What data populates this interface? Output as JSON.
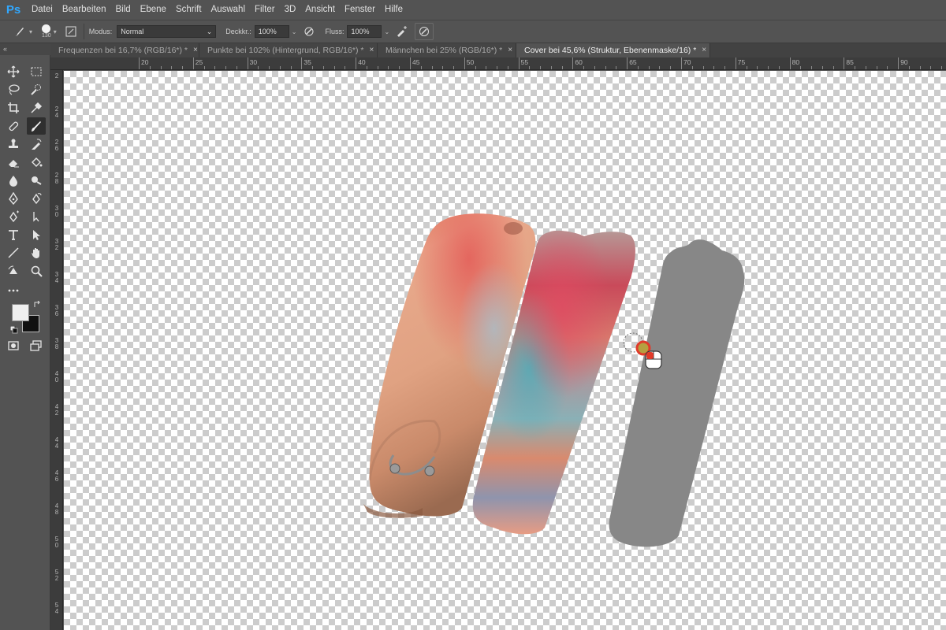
{
  "app": {
    "logo": "Ps"
  },
  "menu": [
    "Datei",
    "Bearbeiten",
    "Bild",
    "Ebene",
    "Schrift",
    "Auswahl",
    "Filter",
    "3D",
    "Ansicht",
    "Fenster",
    "Hilfe"
  ],
  "options": {
    "brush_size": "130",
    "mode_label": "Modus:",
    "mode_value": "Normal",
    "opacity_label": "Deckkr.:",
    "opacity_value": "100%",
    "flow_label": "Fluss:",
    "flow_value": "100%"
  },
  "collapse_label": "«",
  "tabs": [
    {
      "label": "Frequenzen bei 16,7% (RGB/16*) *",
      "close": "×",
      "active": false
    },
    {
      "label": "Punkte bei 102% (Hintergrund, RGB/16*) *",
      "close": "×",
      "active": false
    },
    {
      "label": "Männchen bei 25% (RGB/16*) *",
      "close": "×",
      "active": false
    },
    {
      "label": "Cover bei 45,6% (Struktur, Ebenenmaske/16) *",
      "close": "×",
      "active": true
    }
  ],
  "ruler_top_labels": [
    "20",
    "25",
    "30",
    "35",
    "40",
    "45",
    "50",
    "55",
    "60",
    "65",
    "70",
    "75",
    "80",
    "85",
    "90"
  ],
  "ruler_left_labels": [
    "2",
    "2 4",
    "2 6",
    "2 8",
    "3 0",
    "3 2",
    "3 4",
    "3 6",
    "3 8",
    "4 0",
    "4 2",
    "4 4",
    "4 6",
    "4 8",
    "5 0",
    "5 2",
    "5 4"
  ],
  "colors": {
    "foreground": "#f0f0f0",
    "background": "#111111",
    "accent": "#31a8ff"
  },
  "tools": [
    "move-icon",
    "marquee-icon",
    "lasso-icon",
    "quick-select-icon",
    "crop-icon",
    "eyedropper-icon",
    "healing-icon",
    "brush-icon",
    "stamp-icon",
    "history-brush-icon",
    "eraser-icon",
    "paint-bucket-icon",
    "blur-icon",
    "dodge-icon",
    "pen-icon",
    "freeform-pen-icon",
    "anchor-pen-icon",
    "path-select-icon",
    "type-icon",
    "direct-select-icon",
    "line-icon",
    "hand-icon",
    "rotate-view-icon",
    "zoom-icon",
    "more-tools-icon",
    "quick-mask-icon",
    "screen-mode-icon"
  ]
}
